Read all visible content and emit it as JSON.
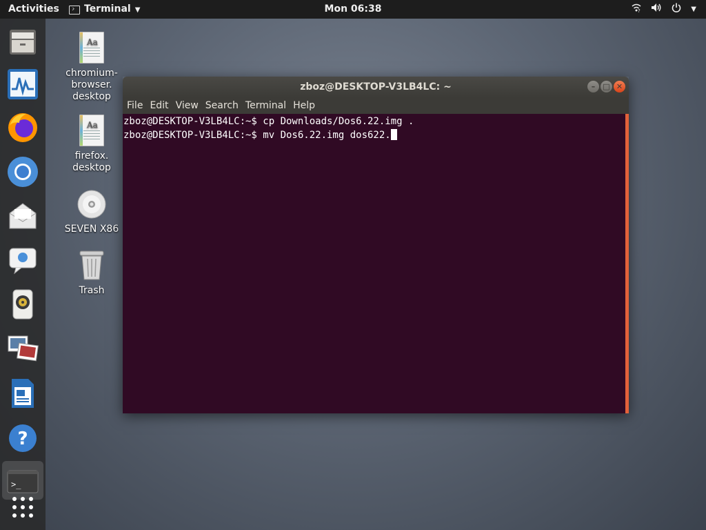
{
  "topbar": {
    "activities": "Activities",
    "app_name": "Terminal",
    "clock": "Mon 06:38"
  },
  "dock": {
    "items": [
      {
        "name": "files-icon"
      },
      {
        "name": "system-monitor-icon"
      },
      {
        "name": "firefox-icon"
      },
      {
        "name": "chromium-icon"
      },
      {
        "name": "mail-icon"
      },
      {
        "name": "chat-icon"
      },
      {
        "name": "music-player-icon"
      },
      {
        "name": "image-viewer-icon"
      },
      {
        "name": "writer-icon"
      },
      {
        "name": "help-icon"
      },
      {
        "name": "terminal-icon"
      },
      {
        "name": "show-apps-icon"
      }
    ]
  },
  "desktop": {
    "icons": [
      {
        "label": "chromium-\nbrowser.\ndesktop"
      },
      {
        "label": "firefox.\ndesktop"
      },
      {
        "label": "SEVEN X86"
      },
      {
        "label": "Trash"
      }
    ]
  },
  "terminal": {
    "title": "zboz@DESKTOP-V3LB4LC: ~",
    "menu": [
      "File",
      "Edit",
      "View",
      "Search",
      "Terminal",
      "Help"
    ],
    "lines": [
      "zboz@DESKTOP-V3LB4LC:~$ cp Downloads/Dos6.22.img .",
      "zboz@DESKTOP-V3LB4LC:~$ mv Dos6.22.img dos622."
    ],
    "colors": {
      "background": "#300a24",
      "accent": "#e3613a"
    }
  }
}
